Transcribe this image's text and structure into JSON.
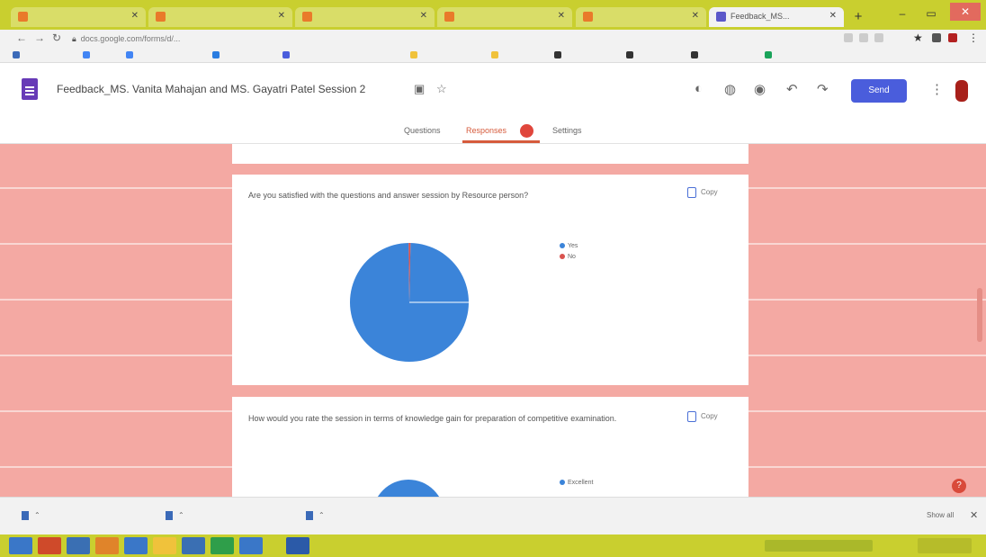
{
  "browser": {
    "tabs": [
      {
        "label": "",
        "active": false
      },
      {
        "label": "",
        "active": false
      },
      {
        "label": "",
        "active": false
      },
      {
        "label": "",
        "active": false
      },
      {
        "label": "",
        "active": false
      },
      {
        "label": "Feedback_MS...",
        "active": true
      }
    ],
    "url": "docs.google.com/forms/d/...",
    "bookmarks": [
      "",
      "",
      "",
      "",
      "",
      "",
      "",
      "",
      "",
      "",
      ""
    ]
  },
  "form": {
    "title": "Feedback_MS. Vanita Mahajan and MS. Gayatri Patel Session 2",
    "send_label": "Send",
    "tabs": {
      "questions": "Questions",
      "responses": "Responses",
      "settings": "Settings"
    },
    "responses_badge": "",
    "colors": {
      "accent": "#4a5ddc",
      "pie_yes": "#3b84d9",
      "pie_no": "#d9534f"
    }
  },
  "cards": [
    {
      "question": "Are you satisfied with the questions and answer session by Resource person?",
      "response_count": "",
      "copy_label": "Copy",
      "legend": [
        "Yes",
        "No"
      ],
      "slice_label": ""
    },
    {
      "question": "How would you rate the session in terms of knowledge gain for preparation of competitive examination.",
      "response_count": "",
      "copy_label": "Copy",
      "legend": [
        "Excellent"
      ]
    }
  ],
  "chart_data": [
    {
      "type": "pie",
      "title": "Are you satisfied with the questions and answer session by Resource person?",
      "categories": [
        "Yes",
        "No"
      ],
      "values": [
        99.5,
        0.5
      ],
      "legend_position": "right"
    }
  ],
  "downloads": {
    "items": [
      "",
      "",
      ""
    ],
    "show_all": "Show all"
  }
}
